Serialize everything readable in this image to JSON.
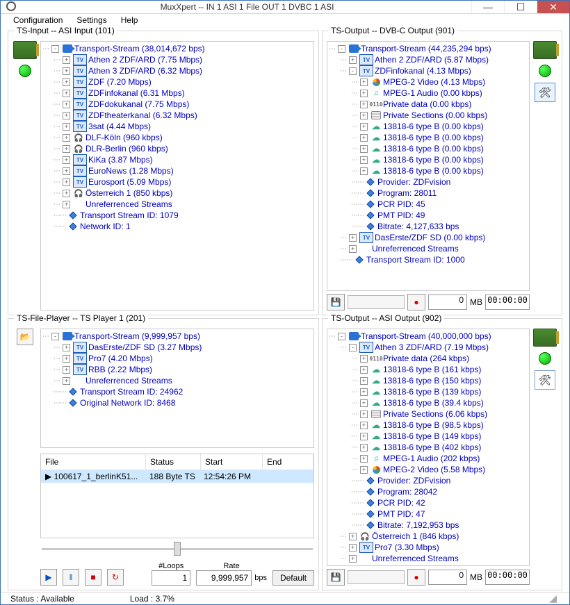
{
  "window": {
    "title": "MuxXpert  --  IN 1 ASI 1 File OUT 1 DVBC 1 ASI"
  },
  "menu": {
    "configuration": "Configuration",
    "settings": "Settings",
    "help": "Help"
  },
  "statusbar": {
    "status_label": "Status :",
    "status_value": "Available",
    "load_label": "Load :",
    "load_value": "3.7%"
  },
  "group_input": {
    "title": "TS-Input -- ASI Input (101)",
    "tree": [
      {
        "l": 0,
        "t": "-",
        "i": "stream",
        "text": "Transport-Stream  (38,014,672 bps)"
      },
      {
        "l": 1,
        "t": "+",
        "i": "tv",
        "text": "Athen 2 ZDF/ARD (7.75 Mbps)"
      },
      {
        "l": 1,
        "t": "+",
        "i": "tv",
        "text": "Athen 3 ZDF/ARD (6.32 Mbps)"
      },
      {
        "l": 1,
        "t": "+",
        "i": "tv",
        "text": "ZDF (7.20 Mbps)"
      },
      {
        "l": 1,
        "t": "+",
        "i": "tv",
        "text": "ZDFinfokanal (6.31 Mbps)"
      },
      {
        "l": 1,
        "t": "+",
        "i": "tv",
        "text": "ZDFdokukanal (7.75 Mbps)"
      },
      {
        "l": 1,
        "t": "+",
        "i": "tv",
        "text": "ZDFtheaterkanal (6.32 Mbps)"
      },
      {
        "l": 1,
        "t": "+",
        "i": "tv",
        "text": "3sat (4.44 Mbps)"
      },
      {
        "l": 1,
        "t": "+",
        "i": "radio",
        "text": "DLF-Köln (960 kbps)"
      },
      {
        "l": 1,
        "t": "+",
        "i": "radio",
        "text": "DLR-Berlin (960 kbps)"
      },
      {
        "l": 1,
        "t": "+",
        "i": "tv",
        "text": "KiKa (3.87 Mbps)"
      },
      {
        "l": 1,
        "t": "+",
        "i": "tv",
        "text": "EuroNews (1.28 Mbps)"
      },
      {
        "l": 1,
        "t": "+",
        "i": "tv",
        "text": "Eurosport (5.09 Mbps)"
      },
      {
        "l": 1,
        "t": "+",
        "i": "radio",
        "text": "Österreich 1 (850 kbps)"
      },
      {
        "l": 1,
        "t": "+",
        "i": "",
        "text": "Unreferrenced Streams"
      },
      {
        "l": 1,
        "t": "",
        "i": "dot",
        "text": "Transport Stream ID: 1079"
      },
      {
        "l": 1,
        "t": "",
        "i": "dot",
        "text": "Network ID: 1"
      }
    ]
  },
  "group_player": {
    "title": "TS-File-Player -- TS Player 1 (201)",
    "tree": [
      {
        "l": 0,
        "t": "-",
        "i": "stream",
        "text": "Transport-Stream  (9,999,957 bps)"
      },
      {
        "l": 1,
        "t": "+",
        "i": "tv",
        "text": "DasErste/ZDF SD (3.27 Mbps)"
      },
      {
        "l": 1,
        "t": "+",
        "i": "tv",
        "text": "Pro7 (4.20 Mbps)"
      },
      {
        "l": 1,
        "t": "+",
        "i": "tv",
        "text": "RBB (2.22 Mbps)"
      },
      {
        "l": 1,
        "t": "+",
        "i": "",
        "text": "Unreferrenced Streams"
      },
      {
        "l": 1,
        "t": "",
        "i": "dot",
        "text": "Transport Stream ID: 24962"
      },
      {
        "l": 1,
        "t": "",
        "i": "dot",
        "text": "Original Network ID: 8468"
      }
    ],
    "table_headers": {
      "file": "File",
      "status": "Status",
      "start": "Start",
      "end": "End"
    },
    "table_rows": [
      {
        "file": "100617_1_berlinK51...",
        "status": "188 Byte TS",
        "start": "12:54:26 PM",
        "end": ""
      }
    ],
    "loops_label": "#Loops",
    "loops_value": "1",
    "rate_label": "Rate",
    "rate_value": "9,999,957",
    "rate_unit": "bps",
    "default_label": "Default"
  },
  "group_out1": {
    "title": "TS-Output -- DVB-C Output (901)",
    "tree": [
      {
        "l": 0,
        "t": "-",
        "i": "stream",
        "text": "Transport-Stream  (44,235,294 bps)"
      },
      {
        "l": 1,
        "t": "+",
        "i": "tv",
        "text": "Athen 2 ZDF/ARD (5.87 Mbps)"
      },
      {
        "l": 1,
        "t": "-",
        "i": "tv",
        "text": "ZDFinfokanal (4.13 Mbps)"
      },
      {
        "l": 2,
        "t": "+",
        "i": "video",
        "text": "MPEG-2 Video (4.13 Mbps)"
      },
      {
        "l": 2,
        "t": "+",
        "i": "audio",
        "text": "MPEG-1 Audio (0.00 kbps)"
      },
      {
        "l": 2,
        "t": "+",
        "i": "data",
        "text": "Private data (0.00 kbps)"
      },
      {
        "l": 2,
        "t": "+",
        "i": "sect",
        "text": "Private Sections (0.00 kbps)"
      },
      {
        "l": 2,
        "t": "+",
        "i": "cloud",
        "text": "13818-6 type B (0.00 kbps)"
      },
      {
        "l": 2,
        "t": "+",
        "i": "cloud",
        "text": "13818-6 type B (0.00 kbps)"
      },
      {
        "l": 2,
        "t": "+",
        "i": "cloud",
        "text": "13818-6 type B (0.00 kbps)"
      },
      {
        "l": 2,
        "t": "+",
        "i": "cloud",
        "text": "13818-6 type B (0.00 kbps)"
      },
      {
        "l": 2,
        "t": "+",
        "i": "cloud",
        "text": "13818-6 type B (0.00 kbps)"
      },
      {
        "l": 2,
        "t": "",
        "i": "dot",
        "text": "Provider: ZDFvision"
      },
      {
        "l": 2,
        "t": "",
        "i": "dot",
        "text": "Program: 28011"
      },
      {
        "l": 2,
        "t": "",
        "i": "dot",
        "text": "PCR PID: 45"
      },
      {
        "l": 2,
        "t": "",
        "i": "dot",
        "text": "PMT PID: 49"
      },
      {
        "l": 2,
        "t": "",
        "i": "dot",
        "text": "Bitrate: 4,127,633 bps"
      },
      {
        "l": 1,
        "t": "+",
        "i": "tv",
        "text": "DasErste/ZDF SD (0.00 kbps)"
      },
      {
        "l": 1,
        "t": "+",
        "i": "",
        "text": "Unreferrenced Streams"
      },
      {
        "l": 1,
        "t": "",
        "i": "dot",
        "text": "Transport Stream ID: 1000"
      }
    ],
    "mb_value": "0",
    "mb_unit": "MB",
    "time": "00:00:00"
  },
  "group_out2": {
    "title": "TS-Output -- ASI Output (902)",
    "tree": [
      {
        "l": 0,
        "t": "-",
        "i": "stream",
        "text": "Transport-Stream  (40,000,000 bps)"
      },
      {
        "l": 1,
        "t": "-",
        "i": "tv",
        "text": "Athen 3 ZDF/ARD (7.19 Mbps)"
      },
      {
        "l": 2,
        "t": "+",
        "i": "data",
        "text": "Private data (264 kbps)"
      },
      {
        "l": 2,
        "t": "+",
        "i": "cloud",
        "text": "13818-6 type B (161 kbps)"
      },
      {
        "l": 2,
        "t": "+",
        "i": "cloud",
        "text": "13818-6 type B (150 kbps)"
      },
      {
        "l": 2,
        "t": "+",
        "i": "cloud",
        "text": "13818-6 type B (139 kbps)"
      },
      {
        "l": 2,
        "t": "+",
        "i": "cloud",
        "text": "13818-6 type B (39.4 kbps)"
      },
      {
        "l": 2,
        "t": "+",
        "i": "sect",
        "text": "Private Sections (6.06 kbps)"
      },
      {
        "l": 2,
        "t": "+",
        "i": "cloud",
        "text": "13818-6 type B (98.5 kbps)"
      },
      {
        "l": 2,
        "t": "+",
        "i": "cloud",
        "text": "13818-6 type B (149 kbps)"
      },
      {
        "l": 2,
        "t": "+",
        "i": "cloud",
        "text": "13818-6 type B (402 kbps)"
      },
      {
        "l": 2,
        "t": "+",
        "i": "audio",
        "text": "MPEG-1 Audio (202 kbps)"
      },
      {
        "l": 2,
        "t": "+",
        "i": "video",
        "text": "MPEG-2 Video (5.58 Mbps)"
      },
      {
        "l": 2,
        "t": "",
        "i": "dot",
        "text": "Provider: ZDFvision"
      },
      {
        "l": 2,
        "t": "",
        "i": "dot",
        "text": "Program: 28042"
      },
      {
        "l": 2,
        "t": "",
        "i": "dot",
        "text": "PCR PID: 42"
      },
      {
        "l": 2,
        "t": "",
        "i": "dot",
        "text": "PMT PID: 47"
      },
      {
        "l": 2,
        "t": "",
        "i": "dot",
        "text": "Bitrate: 7,192,953 bps"
      },
      {
        "l": 1,
        "t": "+",
        "i": "radio",
        "text": "Österreich 1 (846 kbps)"
      },
      {
        "l": 1,
        "t": "+",
        "i": "tv",
        "text": "Pro7 (3.30 Mbps)"
      },
      {
        "l": 1,
        "t": "+",
        "i": "",
        "text": "Unreferrenced Streams"
      }
    ],
    "mb_value": "0",
    "mb_unit": "MB",
    "time": "00:00:00"
  }
}
